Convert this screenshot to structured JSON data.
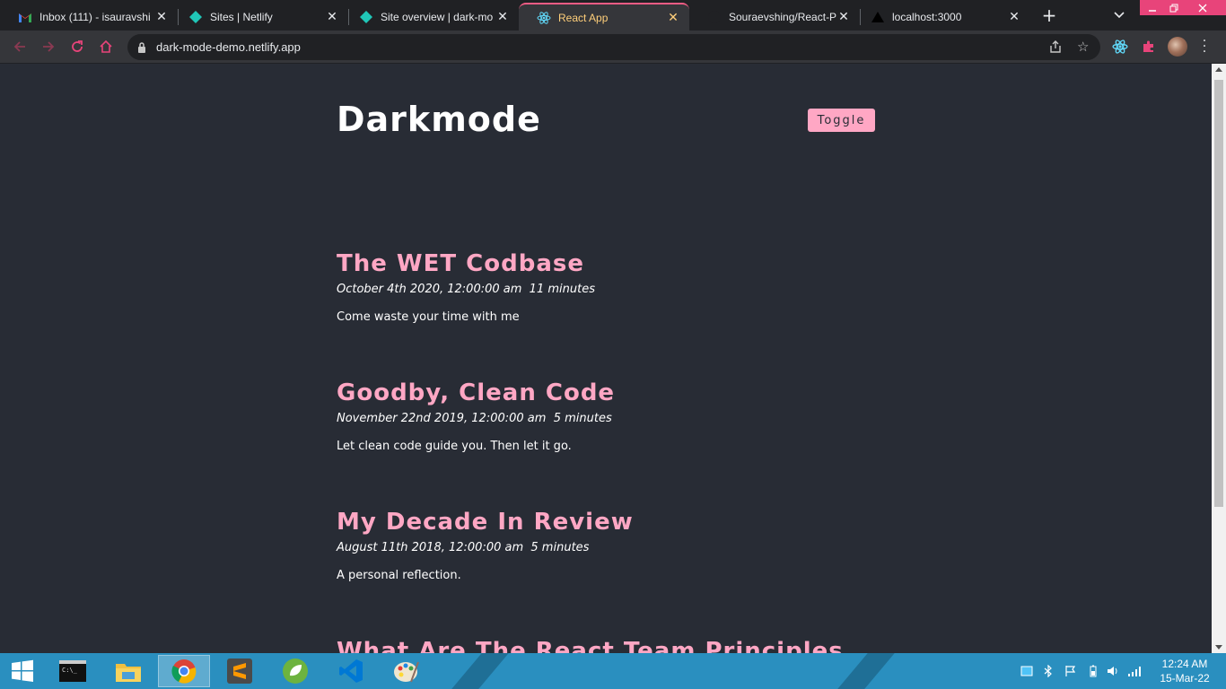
{
  "browser": {
    "tabs": [
      {
        "title": "Inbox (111) - isauravshi",
        "icon": "gmail-icon",
        "active": false
      },
      {
        "title": "Sites | Netlify",
        "icon": "netlify-icon",
        "active": false
      },
      {
        "title": "Site overview | dark-mo",
        "icon": "netlify-icon",
        "active": false
      },
      {
        "title": "React App",
        "icon": "react-icon",
        "active": true
      },
      {
        "title": "Souraevshing/React-Pro",
        "icon": "github-icon",
        "active": false
      },
      {
        "title": "localhost:3000",
        "icon": "vercel-icon",
        "active": false
      }
    ],
    "url": "dark-mode-demo.netlify.app",
    "accent": "#f25c84"
  },
  "site": {
    "title": "Darkmode",
    "toggle_label": "Toggle",
    "accent": "#ffa7c4",
    "background": "#282c35"
  },
  "posts": [
    {
      "title": "The WET Codbase",
      "date": "October 4th 2020, 12:00:00 am",
      "read_time": "11 minutes",
      "excerpt": "Come waste your time with me"
    },
    {
      "title": "Goodby, Clean Code",
      "date": "November 22nd 2019, 12:00:00 am",
      "read_time": "5 minutes",
      "excerpt": "Let clean code guide you. Then let it go."
    },
    {
      "title": "My Decade In Review",
      "date": "August 11th 2018, 12:00:00 am",
      "read_time": "5 minutes",
      "excerpt": "A personal reflection."
    },
    {
      "title": "What Are The React Team Principles",
      "date": "",
      "read_time": "",
      "excerpt": ""
    }
  ],
  "taskbar": {
    "apps": [
      "cmd-icon",
      "file-explorer-icon",
      "chrome-icon",
      "sublime-text-icon",
      "spring-tool-icon",
      "vscode-icon",
      "paint-icon"
    ],
    "time": "12:24 AM",
    "date": "15-Mar-22"
  }
}
